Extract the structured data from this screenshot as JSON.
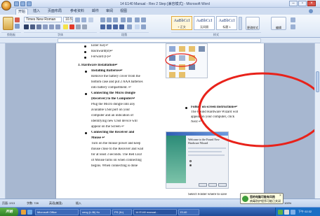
{
  "window": {
    "title": "14 E140 Manual - Rev 2 Step [兼容模式] - Microsoft Word"
  },
  "ribbon": {
    "tabs": [
      "开始",
      "插入",
      "页面布局",
      "参考资料",
      "邮件",
      "审阅",
      "视图"
    ],
    "font_name": "Times New Roman",
    "font_size": "10.5",
    "styles": [
      {
        "preview": "AaBbCcI",
        "name": "+ 正文"
      },
      {
        "preview": "AaBbCcI",
        "name": "无间隔"
      },
      {
        "preview": "AaBbCcI",
        "name": "标题 1"
      }
    ],
    "change_styles": "更改样式",
    "edit_label": "编辑",
    "group_labels": [
      "剪贴板",
      "字体",
      "段落",
      "样式"
    ]
  },
  "document": {
    "left_col": [
      {
        "kind": "bullet",
        "text": "Enter Key↵"
      },
      {
        "kind": "bullet",
        "text": "Backward(B)↵"
      },
      {
        "kind": "bullet",
        "text": "Forward (F)↵"
      },
      {
        "kind": "heading",
        "text": "3.  Hardware Installation↵"
      },
      {
        "kind": "sub",
        "text": "Installing Batteries↵"
      },
      {
        "kind": "para",
        "text": "Remove the battery cover from the"
      },
      {
        "kind": "para",
        "text": "bottom case and put 2 AAA batteries"
      },
      {
        "kind": "para",
        "text": "into battery compartment. ↵"
      },
      {
        "kind": "sub",
        "text": "Connecting the Micro Dongle"
      },
      {
        "kind": "subc",
        "text": "(Receiver) to the Computer↵"
      },
      {
        "kind": "para",
        "text": "Plug the Micro dongle into any"
      },
      {
        "kind": "para",
        "text": "available USB port on your"
      },
      {
        "kind": "para",
        "text": "computer and an indication of"
      },
      {
        "kind": "para",
        "text": "identifying new USB device will"
      },
      {
        "kind": "para",
        "text": "appear on the Screen ↵"
      },
      {
        "kind": "sub",
        "text": "Connecting the Receiver and"
      },
      {
        "kind": "subc",
        "text": "Mouse ↵"
      },
      {
        "kind": "para",
        "text": "Turn on the mouse power and keep"
      },
      {
        "kind": "para",
        "text": "mouse close to the Receiver and wait"
      },
      {
        "kind": "para",
        "text": "for at least 3 seconds. The Red LED"
      },
      {
        "kind": "para",
        "text": "of Mouse turns on when connecting"
      },
      {
        "kind": "para",
        "text": "begins. When connecting is done"
      }
    ],
    "right_col": [
      "Follow on screen instructions↵",
      "The Found Hardware Wizard will",
      "appear on your computer, click",
      "Next ↵"
    ],
    "bottom_text": "Select Folder where to save",
    "wizard_title": "Welcome to the Found New Hardware Wizard"
  },
  "statusbar": {
    "page": "页面: 2/13",
    "words": "字数: 728",
    "language": "英语(美国)",
    "mode": "插入",
    "zoom": "100%"
  },
  "taskbar": {
    "start": "开始",
    "tasks": [
      "Microsoft Office",
      "ceng (L:Bi) Kc",
      "PS (Kr)",
      "14 E140 manual...",
      "E140"
    ],
    "clock": "下午 02:32"
  },
  "balloon": {
    "title": "您的电脑可能有风险",
    "text": "病毒防护程序可能已关闭"
  },
  "colors": {
    "annotation": "#e8221a",
    "ribbon_bg": "#dce7f6",
    "taskbar": "#1f4a96"
  }
}
